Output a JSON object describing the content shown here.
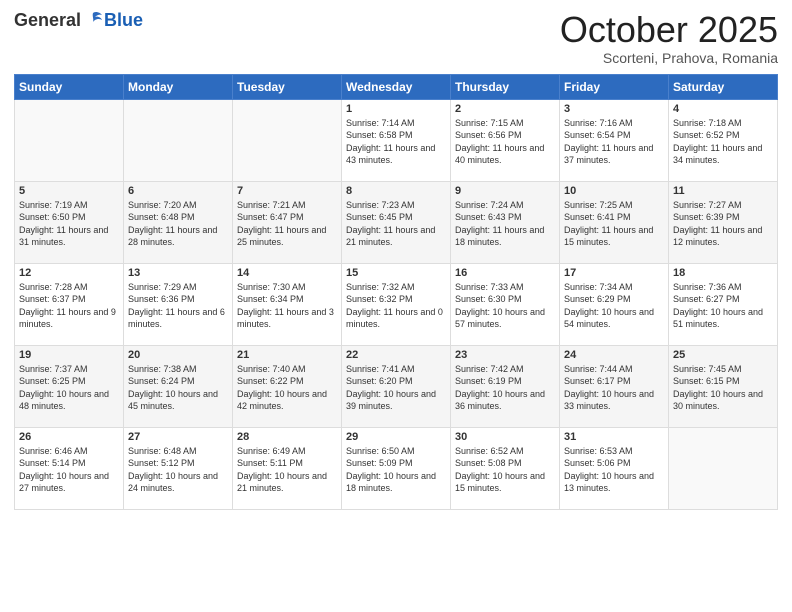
{
  "header": {
    "logo_general": "General",
    "logo_blue": "Blue",
    "month_title": "October 2025",
    "subtitle": "Scorteni, Prahova, Romania"
  },
  "weekdays": [
    "Sunday",
    "Monday",
    "Tuesday",
    "Wednesday",
    "Thursday",
    "Friday",
    "Saturday"
  ],
  "weeks": [
    [
      {
        "day": "",
        "info": ""
      },
      {
        "day": "",
        "info": ""
      },
      {
        "day": "",
        "info": ""
      },
      {
        "day": "1",
        "info": "Sunrise: 7:14 AM\nSunset: 6:58 PM\nDaylight: 11 hours and 43 minutes."
      },
      {
        "day": "2",
        "info": "Sunrise: 7:15 AM\nSunset: 6:56 PM\nDaylight: 11 hours and 40 minutes."
      },
      {
        "day": "3",
        "info": "Sunrise: 7:16 AM\nSunset: 6:54 PM\nDaylight: 11 hours and 37 minutes."
      },
      {
        "day": "4",
        "info": "Sunrise: 7:18 AM\nSunset: 6:52 PM\nDaylight: 11 hours and 34 minutes."
      }
    ],
    [
      {
        "day": "5",
        "info": "Sunrise: 7:19 AM\nSunset: 6:50 PM\nDaylight: 11 hours and 31 minutes."
      },
      {
        "day": "6",
        "info": "Sunrise: 7:20 AM\nSunset: 6:48 PM\nDaylight: 11 hours and 28 minutes."
      },
      {
        "day": "7",
        "info": "Sunrise: 7:21 AM\nSunset: 6:47 PM\nDaylight: 11 hours and 25 minutes."
      },
      {
        "day": "8",
        "info": "Sunrise: 7:23 AM\nSunset: 6:45 PM\nDaylight: 11 hours and 21 minutes."
      },
      {
        "day": "9",
        "info": "Sunrise: 7:24 AM\nSunset: 6:43 PM\nDaylight: 11 hours and 18 minutes."
      },
      {
        "day": "10",
        "info": "Sunrise: 7:25 AM\nSunset: 6:41 PM\nDaylight: 11 hours and 15 minutes."
      },
      {
        "day": "11",
        "info": "Sunrise: 7:27 AM\nSunset: 6:39 PM\nDaylight: 11 hours and 12 minutes."
      }
    ],
    [
      {
        "day": "12",
        "info": "Sunrise: 7:28 AM\nSunset: 6:37 PM\nDaylight: 11 hours and 9 minutes."
      },
      {
        "day": "13",
        "info": "Sunrise: 7:29 AM\nSunset: 6:36 PM\nDaylight: 11 hours and 6 minutes."
      },
      {
        "day": "14",
        "info": "Sunrise: 7:30 AM\nSunset: 6:34 PM\nDaylight: 11 hours and 3 minutes."
      },
      {
        "day": "15",
        "info": "Sunrise: 7:32 AM\nSunset: 6:32 PM\nDaylight: 11 hours and 0 minutes."
      },
      {
        "day": "16",
        "info": "Sunrise: 7:33 AM\nSunset: 6:30 PM\nDaylight: 10 hours and 57 minutes."
      },
      {
        "day": "17",
        "info": "Sunrise: 7:34 AM\nSunset: 6:29 PM\nDaylight: 10 hours and 54 minutes."
      },
      {
        "day": "18",
        "info": "Sunrise: 7:36 AM\nSunset: 6:27 PM\nDaylight: 10 hours and 51 minutes."
      }
    ],
    [
      {
        "day": "19",
        "info": "Sunrise: 7:37 AM\nSunset: 6:25 PM\nDaylight: 10 hours and 48 minutes."
      },
      {
        "day": "20",
        "info": "Sunrise: 7:38 AM\nSunset: 6:24 PM\nDaylight: 10 hours and 45 minutes."
      },
      {
        "day": "21",
        "info": "Sunrise: 7:40 AM\nSunset: 6:22 PM\nDaylight: 10 hours and 42 minutes."
      },
      {
        "day": "22",
        "info": "Sunrise: 7:41 AM\nSunset: 6:20 PM\nDaylight: 10 hours and 39 minutes."
      },
      {
        "day": "23",
        "info": "Sunrise: 7:42 AM\nSunset: 6:19 PM\nDaylight: 10 hours and 36 minutes."
      },
      {
        "day": "24",
        "info": "Sunrise: 7:44 AM\nSunset: 6:17 PM\nDaylight: 10 hours and 33 minutes."
      },
      {
        "day": "25",
        "info": "Sunrise: 7:45 AM\nSunset: 6:15 PM\nDaylight: 10 hours and 30 minutes."
      }
    ],
    [
      {
        "day": "26",
        "info": "Sunrise: 6:46 AM\nSunset: 5:14 PM\nDaylight: 10 hours and 27 minutes."
      },
      {
        "day": "27",
        "info": "Sunrise: 6:48 AM\nSunset: 5:12 PM\nDaylight: 10 hours and 24 minutes."
      },
      {
        "day": "28",
        "info": "Sunrise: 6:49 AM\nSunset: 5:11 PM\nDaylight: 10 hours and 21 minutes."
      },
      {
        "day": "29",
        "info": "Sunrise: 6:50 AM\nSunset: 5:09 PM\nDaylight: 10 hours and 18 minutes."
      },
      {
        "day": "30",
        "info": "Sunrise: 6:52 AM\nSunset: 5:08 PM\nDaylight: 10 hours and 15 minutes."
      },
      {
        "day": "31",
        "info": "Sunrise: 6:53 AM\nSunset: 5:06 PM\nDaylight: 10 hours and 13 minutes."
      },
      {
        "day": "",
        "info": ""
      }
    ]
  ]
}
